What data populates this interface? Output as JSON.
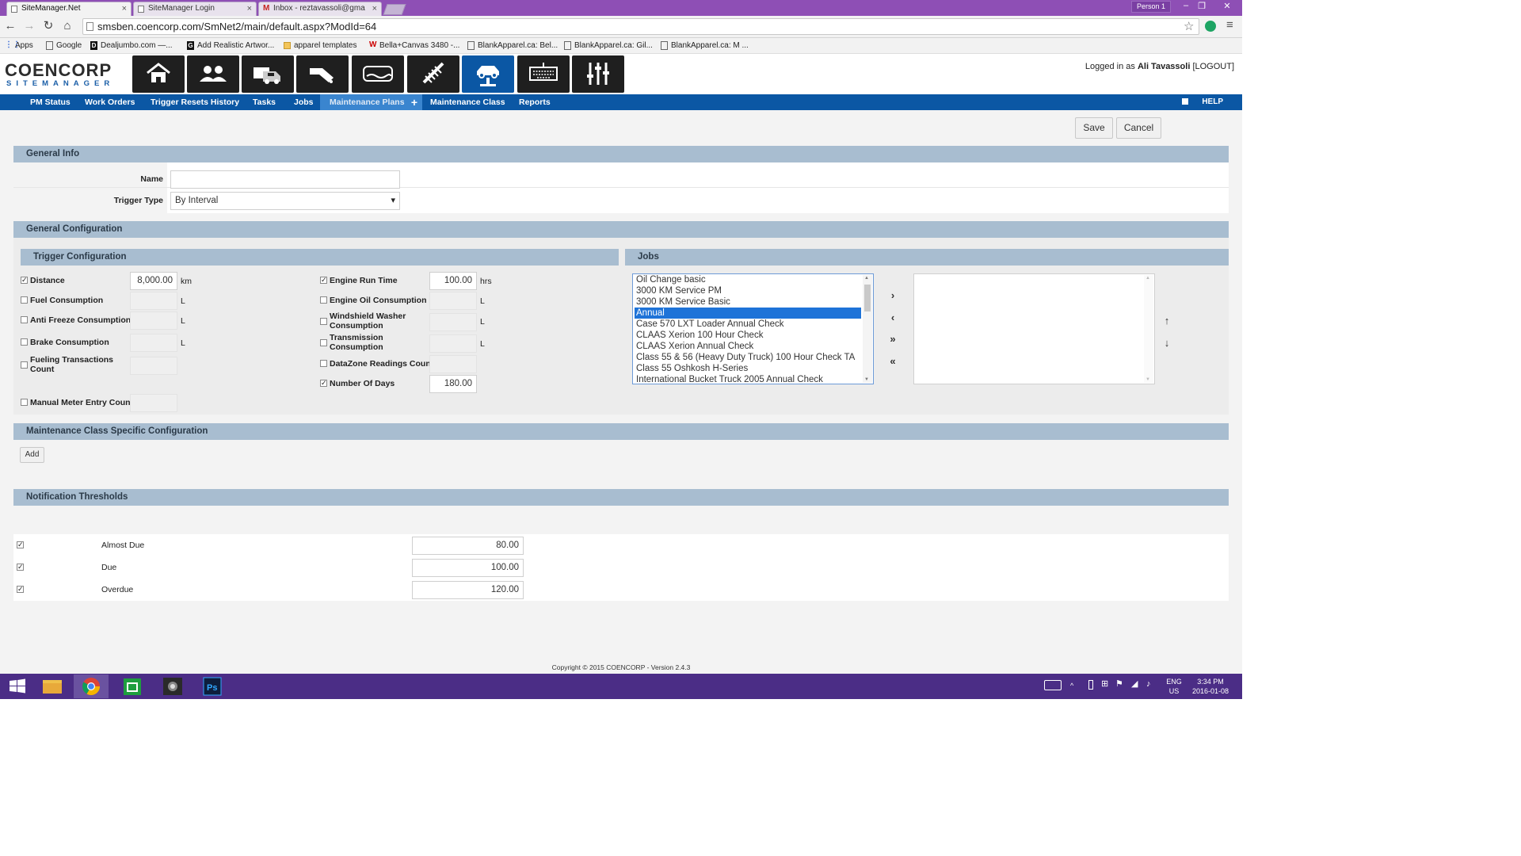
{
  "browser": {
    "tabs": [
      {
        "title": "SiteManager.Net",
        "active": true
      },
      {
        "title": "SiteManager Login",
        "active": false
      },
      {
        "title": "Inbox - reztavassoli@gma",
        "active": false
      }
    ],
    "person": "Person 1",
    "url": "smsben.coencorp.com/SmNet2/main/default.aspx?ModId=64",
    "bookmarks": [
      "Apps",
      "Google",
      "Dealjumbo.com —...",
      "Add Realistic Artwor...",
      "apparel templates",
      "Bella+Canvas 3480 -...",
      "BlankApparel.ca: Bel...",
      "BlankApparel.ca: Gil...",
      "BlankApparel.ca: M ..."
    ]
  },
  "header": {
    "logo_line1": "COENCORP",
    "logo_line2": "SITEMANAGER",
    "modules": [
      "home-icon",
      "users-icon",
      "fleet-icon",
      "fuel-icon",
      "tank-icon",
      "parts-icon",
      "maintenance-lift-icon",
      "keyboard-icon",
      "settings-sliders-icon"
    ],
    "login_prefix": "Logged in as",
    "user": "Ali Tavassoli",
    "logout": "[LOGOUT]"
  },
  "nav": {
    "items": [
      "PM Status",
      "Work Orders",
      "Trigger Resets History",
      "Tasks",
      "Jobs",
      "Maintenance Plans",
      "+",
      "Maintenance Class",
      "Reports"
    ],
    "help": "HELP"
  },
  "actions": {
    "save": "Save",
    "cancel": "Cancel"
  },
  "general_info": {
    "title": "General Info",
    "name_label": "Name",
    "name_value": "",
    "trigger_type_label": "Trigger Type",
    "trigger_type_value": "By Interval"
  },
  "general_config": {
    "title": "General Configuration",
    "trigger_title": "Trigger Configuration",
    "jobs_title": "Jobs",
    "left_triggers": [
      {
        "label": "Distance",
        "checked": true,
        "value": "8,000.00",
        "unit": "km"
      },
      {
        "label": "Fuel Consumption",
        "checked": false,
        "value": "",
        "unit": "L"
      },
      {
        "label": "Anti Freeze Consumption",
        "checked": false,
        "value": "",
        "unit": "L"
      },
      {
        "label": "Brake Consumption",
        "checked": false,
        "value": "",
        "unit": "L"
      },
      {
        "label": "Fueling Transactions Count",
        "checked": false,
        "value": "",
        "unit": ""
      },
      {
        "label": "Manual Meter Entry Count",
        "checked": false,
        "value": "",
        "unit": ""
      }
    ],
    "right_triggers": [
      {
        "label": "Engine Run Time",
        "checked": true,
        "value": "100.00",
        "unit": "hrs"
      },
      {
        "label": "Engine Oil Consumption",
        "checked": false,
        "value": "",
        "unit": "L"
      },
      {
        "label": "Windshield Washer Consumption",
        "checked": false,
        "value": "",
        "unit": "L"
      },
      {
        "label": "Transmission Consumption",
        "checked": false,
        "value": "",
        "unit": "L"
      },
      {
        "label": "DataZone Readings Count",
        "checked": false,
        "value": "",
        "unit": ""
      },
      {
        "label": "Number Of Days",
        "checked": true,
        "value": "180.00",
        "unit": ""
      }
    ],
    "available_jobs": [
      "Oil Change basic",
      "3000 KM Service PM",
      "3000 KM Service Basic",
      "Annual",
      "Case 570 LXT Loader Annual Check",
      "CLAAS Xerion 100 Hour Check",
      "CLAAS Xerion Annual Check",
      "Class 55 & 56 (Heavy Duty Truck) 100 Hour Check TA",
      "Class 55 Oshkosh H-Series",
      "International Bucket Truck 2005 Annual Check"
    ],
    "selected_job": "Annual",
    "transfer_buttons": [
      "›",
      "‹",
      "»",
      "«"
    ],
    "order_buttons": [
      "↑",
      "↓"
    ]
  },
  "class_config": {
    "title": "Maintenance Class Specific Configuration",
    "add": "Add"
  },
  "thresholds": {
    "title": "Notification Thresholds",
    "rows": [
      {
        "label": "Almost Due",
        "checked": true,
        "value": "80.00"
      },
      {
        "label": "Due",
        "checked": true,
        "value": "100.00"
      },
      {
        "label": "Overdue",
        "checked": true,
        "value": "120.00"
      }
    ]
  },
  "footer": "Copyright © 2015 COENCORP - Version 2.4.3",
  "taskbar": {
    "lang1": "ENG",
    "lang2": "US",
    "time": "3:34 PM",
    "date": "2016-01-08"
  },
  "colors": {
    "nav": "#0b57a4",
    "section": "#a8bdd0",
    "selection": "#1e73d8",
    "taskbar": "#4b2d86",
    "titlebar": "#8e4fb5"
  }
}
